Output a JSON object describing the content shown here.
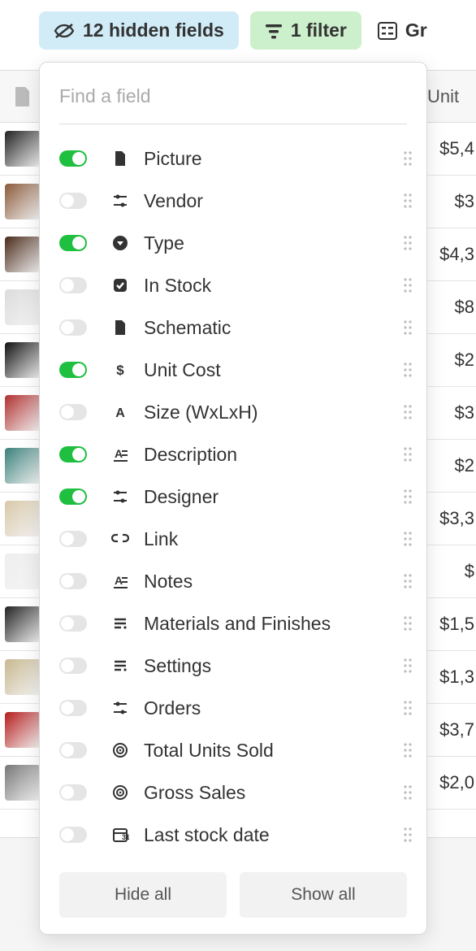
{
  "toolbar": {
    "hidden_fields_label": "12 hidden fields",
    "filter_label": "1 filter",
    "group_label": "Gr"
  },
  "grid": {
    "price_header": "Unit",
    "rows": [
      {
        "thumb_tint": "#222",
        "price": "$5,4"
      },
      {
        "thumb_tint": "#8a5a3a",
        "price": "$3"
      },
      {
        "thumb_tint": "#4a2a1a",
        "price": "$4,3"
      },
      {
        "thumb_tint": "#dcdcdc",
        "price": "$8"
      },
      {
        "thumb_tint": "#111",
        "price": "$2"
      },
      {
        "thumb_tint": "#b03030",
        "price": "$3"
      },
      {
        "thumb_tint": "#3a807a",
        "price": "$2"
      },
      {
        "thumb_tint": "#d8c8a8",
        "price": "$3,3"
      },
      {
        "thumb_tint": "#eee",
        "price": "$"
      },
      {
        "thumb_tint": "#222",
        "price": "$1,5"
      },
      {
        "thumb_tint": "#c8b890",
        "price": "$1,3"
      },
      {
        "thumb_tint": "#b51d1d",
        "price": "$3,7"
      },
      {
        "thumb_tint": "#777",
        "price": "$2,0"
      }
    ]
  },
  "panel": {
    "search_placeholder": "Find a field",
    "hide_all_label": "Hide all",
    "show_all_label": "Show all",
    "fields": [
      {
        "label": "Picture",
        "icon": "file",
        "on": true
      },
      {
        "label": "Vendor",
        "icon": "sliders",
        "on": false
      },
      {
        "label": "Type",
        "icon": "dropdown",
        "on": true
      },
      {
        "label": "In Stock",
        "icon": "checkbox",
        "on": false
      },
      {
        "label": "Schematic",
        "icon": "file",
        "on": false
      },
      {
        "label": "Unit Cost",
        "icon": "currency",
        "on": true
      },
      {
        "label": "Size (WxLxH)",
        "icon": "text",
        "on": false
      },
      {
        "label": "Description",
        "icon": "longtext",
        "on": true
      },
      {
        "label": "Designer",
        "icon": "sliders",
        "on": true
      },
      {
        "label": "Link",
        "icon": "link",
        "on": false
      },
      {
        "label": "Notes",
        "icon": "longtext",
        "on": false
      },
      {
        "label": "Materials and Finishes",
        "icon": "list",
        "on": false
      },
      {
        "label": "Settings",
        "icon": "list",
        "on": false
      },
      {
        "label": "Orders",
        "icon": "sliders",
        "on": false
      },
      {
        "label": "Total Units Sold",
        "icon": "spiral",
        "on": false
      },
      {
        "label": "Gross Sales",
        "icon": "spiral",
        "on": false
      },
      {
        "label": "Last stock date",
        "icon": "calendar",
        "on": false
      }
    ]
  }
}
